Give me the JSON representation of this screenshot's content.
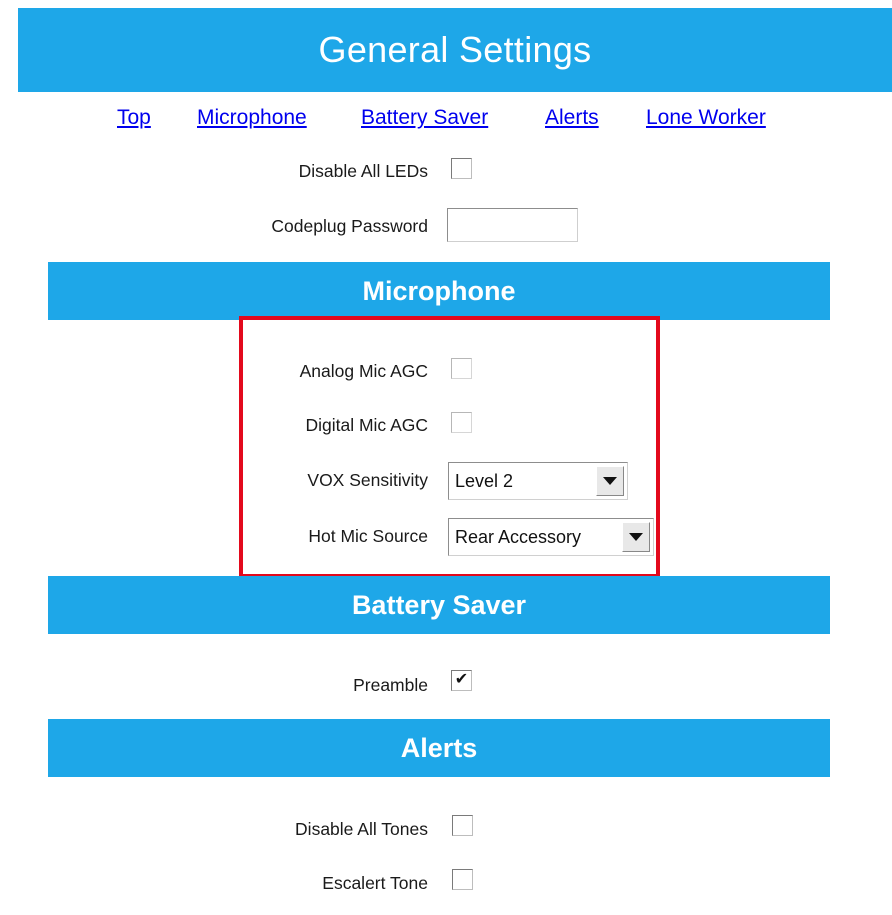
{
  "header": {
    "title": "General Settings"
  },
  "nav": {
    "top": "Top",
    "microphone": "Microphone",
    "battery_saver": "Battery Saver",
    "alerts": "Alerts",
    "lone_worker": "Lone Worker"
  },
  "general": {
    "disable_all_leds_label": "Disable All LEDs",
    "disable_all_leds_checked": false,
    "codeplug_password_label": "Codeplug Password",
    "codeplug_password_value": ""
  },
  "microphone": {
    "title": "Microphone",
    "analog_mic_agc_label": "Analog Mic AGC",
    "analog_mic_agc_checked": false,
    "digital_mic_agc_label": "Digital Mic AGC",
    "digital_mic_agc_checked": false,
    "vox_sensitivity_label": "VOX Sensitivity",
    "vox_sensitivity_value": "Level 2",
    "hot_mic_source_label": "Hot Mic Source",
    "hot_mic_source_value": "Rear Accessory"
  },
  "battery_saver": {
    "title": "Battery Saver",
    "preamble_label": "Preamble",
    "preamble_checked": true
  },
  "alerts": {
    "title": "Alerts",
    "disable_all_tones_label": "Disable All Tones",
    "disable_all_tones_checked": false,
    "escalert_tone_label": "Escalert Tone",
    "escalert_tone_checked": false
  },
  "colors": {
    "header_blue": "#1ea7e8",
    "link_blue": "#0000ee",
    "highlight_red": "#e3091c"
  }
}
